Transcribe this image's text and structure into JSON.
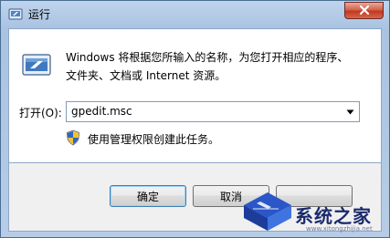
{
  "window": {
    "title": "运行"
  },
  "content": {
    "description_line1": "Windows 将根据您所输入的名称，为您打开相应的程序、",
    "description_line2": "文件夹、文档或 Internet 资源。",
    "open_label": "打开(O):",
    "open_value": "gpedit.msc",
    "admin_note": "使用管理权限创建此任务。"
  },
  "buttons": {
    "ok": "确定",
    "cancel": "取消",
    "browse": ""
  },
  "watermark": {
    "brand": "系统之家",
    "url": "www.xitongzhijia.net"
  },
  "icons": {
    "title": "run-app-icon",
    "dialog": "run-app-icon",
    "shield": "uac-shield-icon",
    "close": "close-icon",
    "dropdown": "chevron-down-icon"
  }
}
